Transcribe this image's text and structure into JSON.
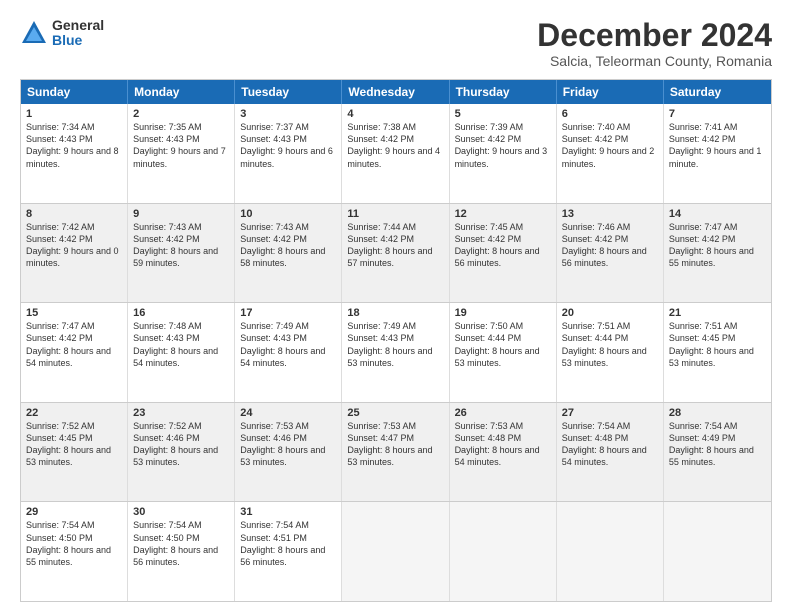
{
  "logo": {
    "general": "General",
    "blue": "Blue"
  },
  "title": "December 2024",
  "subtitle": "Salcia, Teleorman County, Romania",
  "headers": [
    "Sunday",
    "Monday",
    "Tuesday",
    "Wednesday",
    "Thursday",
    "Friday",
    "Saturday"
  ],
  "weeks": [
    [
      {
        "day": "1",
        "sunrise": "Sunrise: 7:34 AM",
        "sunset": "Sunset: 4:43 PM",
        "daylight": "Daylight: 9 hours and 8 minutes.",
        "shaded": false
      },
      {
        "day": "2",
        "sunrise": "Sunrise: 7:35 AM",
        "sunset": "Sunset: 4:43 PM",
        "daylight": "Daylight: 9 hours and 7 minutes.",
        "shaded": false
      },
      {
        "day": "3",
        "sunrise": "Sunrise: 7:37 AM",
        "sunset": "Sunset: 4:43 PM",
        "daylight": "Daylight: 9 hours and 6 minutes.",
        "shaded": false
      },
      {
        "day": "4",
        "sunrise": "Sunrise: 7:38 AM",
        "sunset": "Sunset: 4:42 PM",
        "daylight": "Daylight: 9 hours and 4 minutes.",
        "shaded": false
      },
      {
        "day": "5",
        "sunrise": "Sunrise: 7:39 AM",
        "sunset": "Sunset: 4:42 PM",
        "daylight": "Daylight: 9 hours and 3 minutes.",
        "shaded": false
      },
      {
        "day": "6",
        "sunrise": "Sunrise: 7:40 AM",
        "sunset": "Sunset: 4:42 PM",
        "daylight": "Daylight: 9 hours and 2 minutes.",
        "shaded": false
      },
      {
        "day": "7",
        "sunrise": "Sunrise: 7:41 AM",
        "sunset": "Sunset: 4:42 PM",
        "daylight": "Daylight: 9 hours and 1 minute.",
        "shaded": false
      }
    ],
    [
      {
        "day": "8",
        "sunrise": "Sunrise: 7:42 AM",
        "sunset": "Sunset: 4:42 PM",
        "daylight": "Daylight: 9 hours and 0 minutes.",
        "shaded": true
      },
      {
        "day": "9",
        "sunrise": "Sunrise: 7:43 AM",
        "sunset": "Sunset: 4:42 PM",
        "daylight": "Daylight: 8 hours and 59 minutes.",
        "shaded": true
      },
      {
        "day": "10",
        "sunrise": "Sunrise: 7:43 AM",
        "sunset": "Sunset: 4:42 PM",
        "daylight": "Daylight: 8 hours and 58 minutes.",
        "shaded": true
      },
      {
        "day": "11",
        "sunrise": "Sunrise: 7:44 AM",
        "sunset": "Sunset: 4:42 PM",
        "daylight": "Daylight: 8 hours and 57 minutes.",
        "shaded": true
      },
      {
        "day": "12",
        "sunrise": "Sunrise: 7:45 AM",
        "sunset": "Sunset: 4:42 PM",
        "daylight": "Daylight: 8 hours and 56 minutes.",
        "shaded": true
      },
      {
        "day": "13",
        "sunrise": "Sunrise: 7:46 AM",
        "sunset": "Sunset: 4:42 PM",
        "daylight": "Daylight: 8 hours and 56 minutes.",
        "shaded": true
      },
      {
        "day": "14",
        "sunrise": "Sunrise: 7:47 AM",
        "sunset": "Sunset: 4:42 PM",
        "daylight": "Daylight: 8 hours and 55 minutes.",
        "shaded": true
      }
    ],
    [
      {
        "day": "15",
        "sunrise": "Sunrise: 7:47 AM",
        "sunset": "Sunset: 4:42 PM",
        "daylight": "Daylight: 8 hours and 54 minutes.",
        "shaded": false
      },
      {
        "day": "16",
        "sunrise": "Sunrise: 7:48 AM",
        "sunset": "Sunset: 4:43 PM",
        "daylight": "Daylight: 8 hours and 54 minutes.",
        "shaded": false
      },
      {
        "day": "17",
        "sunrise": "Sunrise: 7:49 AM",
        "sunset": "Sunset: 4:43 PM",
        "daylight": "Daylight: 8 hours and 54 minutes.",
        "shaded": false
      },
      {
        "day": "18",
        "sunrise": "Sunrise: 7:49 AM",
        "sunset": "Sunset: 4:43 PM",
        "daylight": "Daylight: 8 hours and 53 minutes.",
        "shaded": false
      },
      {
        "day": "19",
        "sunrise": "Sunrise: 7:50 AM",
        "sunset": "Sunset: 4:44 PM",
        "daylight": "Daylight: 8 hours and 53 minutes.",
        "shaded": false
      },
      {
        "day": "20",
        "sunrise": "Sunrise: 7:51 AM",
        "sunset": "Sunset: 4:44 PM",
        "daylight": "Daylight: 8 hours and 53 minutes.",
        "shaded": false
      },
      {
        "day": "21",
        "sunrise": "Sunrise: 7:51 AM",
        "sunset": "Sunset: 4:45 PM",
        "daylight": "Daylight: 8 hours and 53 minutes.",
        "shaded": false
      }
    ],
    [
      {
        "day": "22",
        "sunrise": "Sunrise: 7:52 AM",
        "sunset": "Sunset: 4:45 PM",
        "daylight": "Daylight: 8 hours and 53 minutes.",
        "shaded": true
      },
      {
        "day": "23",
        "sunrise": "Sunrise: 7:52 AM",
        "sunset": "Sunset: 4:46 PM",
        "daylight": "Daylight: 8 hours and 53 minutes.",
        "shaded": true
      },
      {
        "day": "24",
        "sunrise": "Sunrise: 7:53 AM",
        "sunset": "Sunset: 4:46 PM",
        "daylight": "Daylight: 8 hours and 53 minutes.",
        "shaded": true
      },
      {
        "day": "25",
        "sunrise": "Sunrise: 7:53 AM",
        "sunset": "Sunset: 4:47 PM",
        "daylight": "Daylight: 8 hours and 53 minutes.",
        "shaded": true
      },
      {
        "day": "26",
        "sunrise": "Sunrise: 7:53 AM",
        "sunset": "Sunset: 4:48 PM",
        "daylight": "Daylight: 8 hours and 54 minutes.",
        "shaded": true
      },
      {
        "day": "27",
        "sunrise": "Sunrise: 7:54 AM",
        "sunset": "Sunset: 4:48 PM",
        "daylight": "Daylight: 8 hours and 54 minutes.",
        "shaded": true
      },
      {
        "day": "28",
        "sunrise": "Sunrise: 7:54 AM",
        "sunset": "Sunset: 4:49 PM",
        "daylight": "Daylight: 8 hours and 55 minutes.",
        "shaded": true
      }
    ],
    [
      {
        "day": "29",
        "sunrise": "Sunrise: 7:54 AM",
        "sunset": "Sunset: 4:50 PM",
        "daylight": "Daylight: 8 hours and 55 minutes.",
        "shaded": false
      },
      {
        "day": "30",
        "sunrise": "Sunrise: 7:54 AM",
        "sunset": "Sunset: 4:50 PM",
        "daylight": "Daylight: 8 hours and 56 minutes.",
        "shaded": false
      },
      {
        "day": "31",
        "sunrise": "Sunrise: 7:54 AM",
        "sunset": "Sunset: 4:51 PM",
        "daylight": "Daylight: 8 hours and 56 minutes.",
        "shaded": false
      },
      {
        "day": "",
        "sunrise": "",
        "sunset": "",
        "daylight": "",
        "shaded": false,
        "empty": true
      },
      {
        "day": "",
        "sunrise": "",
        "sunset": "",
        "daylight": "",
        "shaded": false,
        "empty": true
      },
      {
        "day": "",
        "sunrise": "",
        "sunset": "",
        "daylight": "",
        "shaded": false,
        "empty": true
      },
      {
        "day": "",
        "sunrise": "",
        "sunset": "",
        "daylight": "",
        "shaded": false,
        "empty": true
      }
    ]
  ]
}
